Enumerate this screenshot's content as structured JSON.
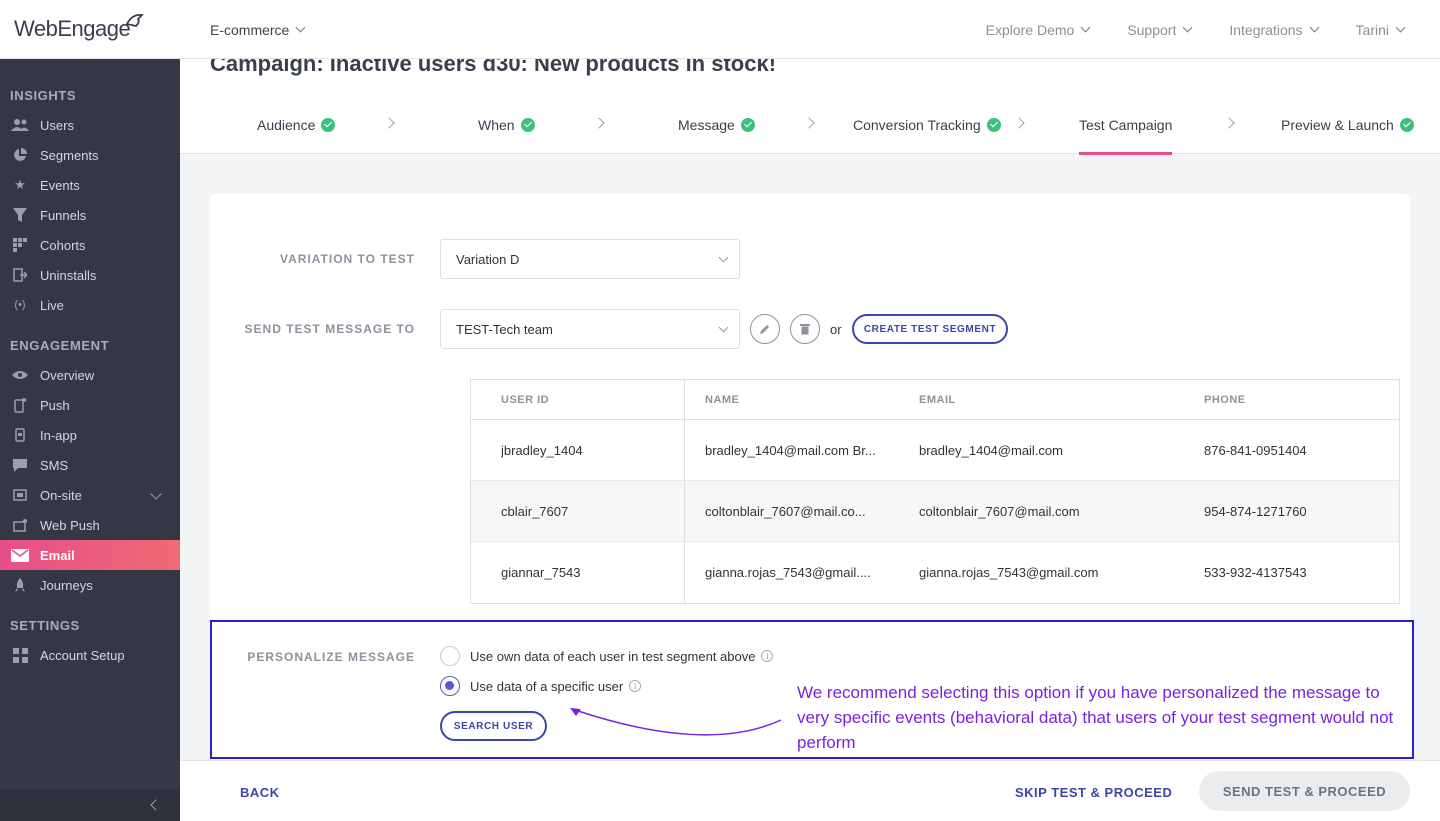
{
  "brand": {
    "logo_text": "WebEngage",
    "accent": "#e84e89",
    "primary": "#3e45a8",
    "annotation_color": "#7a22e0"
  },
  "topbar": {
    "project": "E-commerce",
    "nav": [
      "Explore Demo",
      "Support",
      "Integrations",
      "Tarini"
    ]
  },
  "sidebar": {
    "sections": [
      {
        "title": "INSIGHTS",
        "items": [
          {
            "label": "Users",
            "icon": "users-icon"
          },
          {
            "label": "Segments",
            "icon": "pie-icon"
          },
          {
            "label": "Events",
            "icon": "star-icon"
          },
          {
            "label": "Funnels",
            "icon": "funnel-icon"
          },
          {
            "label": "Cohorts",
            "icon": "grid-icon"
          },
          {
            "label": "Uninstalls",
            "icon": "uninstall-icon"
          },
          {
            "label": "Live",
            "icon": "broadcast-icon"
          }
        ]
      },
      {
        "title": "ENGAGEMENT",
        "items": [
          {
            "label": "Overview",
            "icon": "eye-icon"
          },
          {
            "label": "Push",
            "icon": "mobile-push-icon"
          },
          {
            "label": "In-app",
            "icon": "in-app-icon"
          },
          {
            "label": "SMS",
            "icon": "sms-icon"
          },
          {
            "label": "On-site",
            "icon": "on-site-icon"
          },
          {
            "label": "Web Push",
            "icon": "web-push-icon"
          },
          {
            "label": "Email",
            "icon": "mail-icon"
          },
          {
            "label": "Journeys",
            "icon": "rocket-icon"
          }
        ]
      },
      {
        "title": "SETTINGS",
        "items": [
          {
            "label": "Account Setup",
            "icon": "settings-grid-icon"
          }
        ]
      }
    ]
  },
  "page": {
    "title": "Campaign: Inactive users d30: New products in stock!"
  },
  "steps": [
    "Audience",
    "When",
    "Message",
    "Conversion Tracking",
    "Test Campaign",
    "Preview & Launch"
  ],
  "form": {
    "variation_label": "VARIATION TO TEST",
    "variation_value": "Variation D",
    "send_to_label": "SEND TEST MESSAGE TO",
    "send_to_value": "TEST-Tech team",
    "or_text": "or",
    "create_segment": "CREATE TEST SEGMENT"
  },
  "table": {
    "headers": [
      "USER ID",
      "NAME",
      "EMAIL",
      "PHONE"
    ],
    "rows": [
      [
        "jbradley_1404",
        "bradley_1404@mail.com Br...",
        "bradley_1404@mail.com",
        "876-841-0951404"
      ],
      [
        "cblair_7607",
        "coltonblair_7607@mail.co...",
        "coltonblair_7607@mail.com",
        "954-874-1271760"
      ],
      [
        "giannar_7543",
        "gianna.rojas_7543@gmail....",
        "gianna.rojas_7543@gmail.com",
        "533-932-4137543"
      ]
    ]
  },
  "personalize": {
    "label": "PERSONALIZE MESSAGE",
    "option1": "Use own data of each user in test segment above",
    "option2": "Use data of a specific user",
    "search_user": "SEARCH USER",
    "annotation": "We recommend selecting this option if you have personalized the message to very specific events (behavioral data) that users of your test segment would not perform"
  },
  "footer": {
    "back": "BACK",
    "skip": "SKIP TEST & PROCEED",
    "send": "SEND TEST & PROCEED"
  }
}
